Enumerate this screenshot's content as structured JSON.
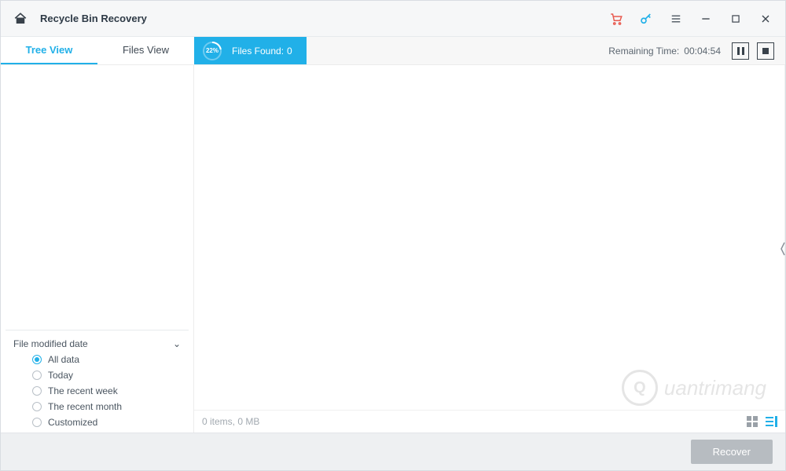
{
  "titlebar": {
    "title": "Recycle Bin Recovery"
  },
  "tabs": {
    "tree": "Tree View",
    "files": "Files View"
  },
  "progress": {
    "percent": "22%",
    "percent_value": 22,
    "files_found_label": "Files Found:",
    "files_found_value": "0"
  },
  "timing": {
    "label": "Remaining Time:",
    "value": "00:04:54"
  },
  "filter": {
    "header": "File modified date",
    "options": {
      "all": "All data",
      "today": "Today",
      "week": "The recent week",
      "month": "The recent month",
      "custom": "Customized"
    },
    "selected": "all"
  },
  "status": {
    "summary": "0 items, 0 MB"
  },
  "footer": {
    "recover_label": "Recover"
  },
  "watermark": {
    "text": "uantrimang"
  }
}
